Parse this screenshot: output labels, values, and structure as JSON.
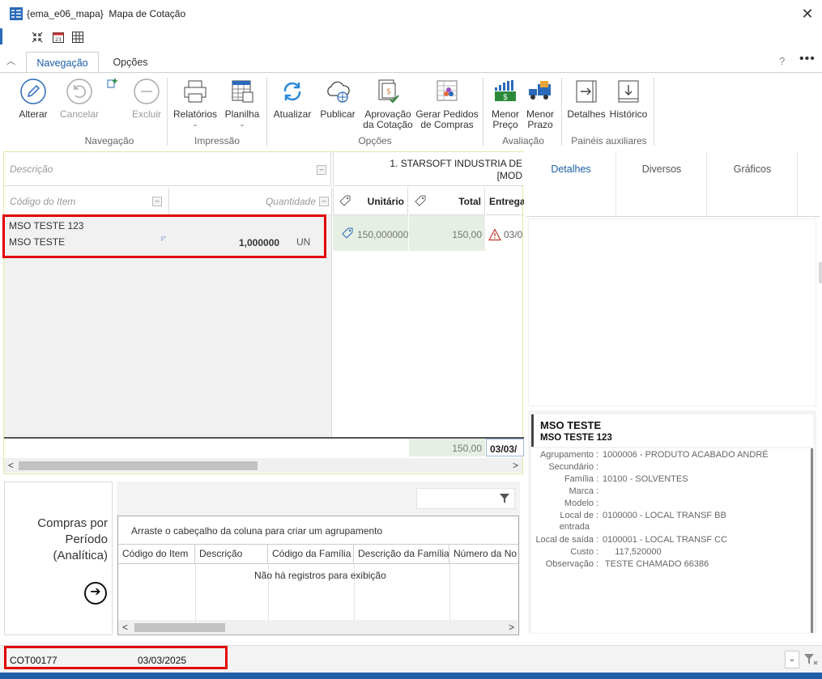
{
  "window": {
    "title": "{ema_e06_mapa}  Mapa de Cotação",
    "close": "✕"
  },
  "ribbon": {
    "tabs": [
      "Navegação",
      "Opções"
    ],
    "help": "?",
    "more": "•••",
    "buttons": {
      "alterar": "Alterar",
      "cancelar": "Cancelar",
      "excluir": "Excluir",
      "relatorios": "Relatórios",
      "planilha": "Planilha",
      "atualizar": "Atualizar",
      "publicar": "Publicar",
      "aprovacao_l1": "Aprovação",
      "aprovacao_l2": "da Cotação",
      "gerar_l1": "Gerar Pedidos",
      "gerar_l2": "de Compras",
      "menor_preco_l1": "Menor",
      "menor_preco_l2": "Preço",
      "menor_prazo_l1": "Menor",
      "menor_prazo_l2": "Prazo",
      "detalhes": "Detalhes",
      "historico": "Histórico"
    },
    "groups": {
      "navegacao": "Navegação",
      "impressao": "Impressão",
      "opcoes": "Opções",
      "avaliacao": "Avaliação",
      "paineis": "Painéis auxiliares"
    }
  },
  "grid": {
    "descricao_header": "Descrição",
    "codigo_header": "Código do Item",
    "quantidade_header": "Quantidade",
    "supplier_line1": "1.  STARSOFT INDUSTRIA DE",
    "supplier_line2": "[MOD",
    "unitario_header": "Unitário",
    "total_header": "Total",
    "entrega_header": "Entrega",
    "item": {
      "code": "MSO TESTE 123",
      "desc": "MSO TESTE",
      "qty": "1,000000",
      "unit": "UN",
      "unit_price": "150,000000",
      "total": "150,00",
      "entrega": "03/0"
    },
    "footer_total": "150,00",
    "footer_date": "03/03/",
    "scroll_left": "<",
    "scroll_right": ">"
  },
  "right_panel": {
    "tabs": [
      "Detalhes",
      "Diversos",
      "Gráficos"
    ],
    "product_name": "MSO TESTE",
    "product_code": "MSO TESTE 123",
    "info": [
      {
        "label": "Agrupamento",
        "value": "1000006 - PRODUTO ACABADO ANDRÉ"
      },
      {
        "label": "Secundário",
        "value": ""
      },
      {
        "label": "Família",
        "value": "10100 - SOLVENTES"
      },
      {
        "label": "Marca",
        "value": ""
      },
      {
        "label": "Modelo",
        "value": ""
      },
      {
        "label": "Local de",
        "label2": "entrada",
        "value": "0100000 - LOCAL TRANSF BB"
      },
      {
        "label": "Local de saída",
        "value": "0100001 - LOCAL TRANSF CC"
      },
      {
        "label": "Custo",
        "value": "     117,520000"
      },
      {
        "label": "Observação",
        "value": " TESTE CHAMADO 66386"
      }
    ]
  },
  "compras": {
    "line1": "Compras por",
    "line2": "Período",
    "line3": "(Analítica)",
    "go": "➔"
  },
  "report": {
    "group_hint": "Arraste o cabeçalho da coluna para criar um agrupamento",
    "columns": [
      "Código do Item",
      "Descrição",
      "Código da Família",
      "Descrição da Família",
      "Número da No"
    ],
    "empty": "Não há registros para exibição"
  },
  "status": {
    "code": "COT00177",
    "date": "03/03/2025",
    "dropdown": "⌄"
  },
  "colors": {
    "accent": "#1a5ea8",
    "highlight": "#e00000",
    "grid_green": "#e6efe4"
  }
}
